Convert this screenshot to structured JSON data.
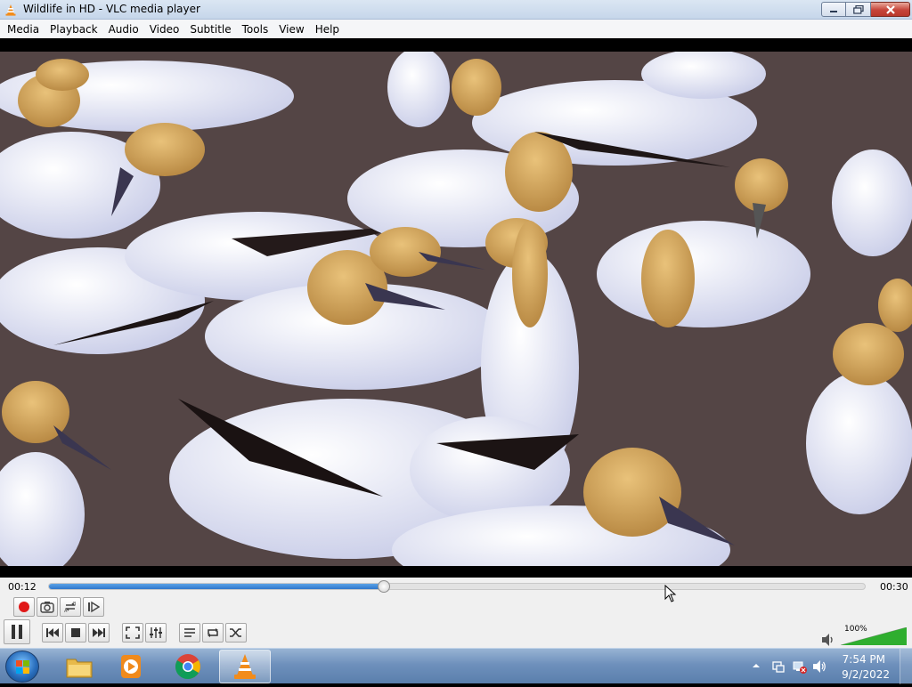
{
  "window": {
    "title": "Wildlife in HD - VLC media player"
  },
  "menu": [
    "Media",
    "Playback",
    "Audio",
    "Video",
    "Subtitle",
    "Tools",
    "View",
    "Help"
  ],
  "player": {
    "elapsed": "00:12",
    "total": "00:30",
    "progress_fraction": 0.41,
    "volume_label": "100%",
    "volume_fraction": 1.0,
    "state": "playing"
  },
  "controls": {
    "record": "record-icon",
    "snapshot": "camera-icon",
    "loop_ab": "loop-ab-icon",
    "frame_by_frame": "frame-step-icon",
    "pause": "pause-icon",
    "previous": "previous-icon",
    "stop": "stop-icon",
    "next": "next-icon",
    "fullscreen": "fullscreen-icon",
    "extended_settings": "equalizer-icon",
    "playlist": "playlist-icon",
    "loop": "loop-icon",
    "shuffle": "shuffle-icon"
  },
  "taskbar": {
    "apps": [
      "windows-explorer-icon",
      "media-player-icon",
      "chrome-icon",
      "vlc-icon"
    ],
    "active_app": "vlc-icon",
    "time": "7:54 PM",
    "date": "9/2/2022"
  },
  "colors": {
    "progress": "#2f77cc",
    "record": "#e01818",
    "vlc_orange": "#f28c1b",
    "volume": "#2fae2f"
  }
}
